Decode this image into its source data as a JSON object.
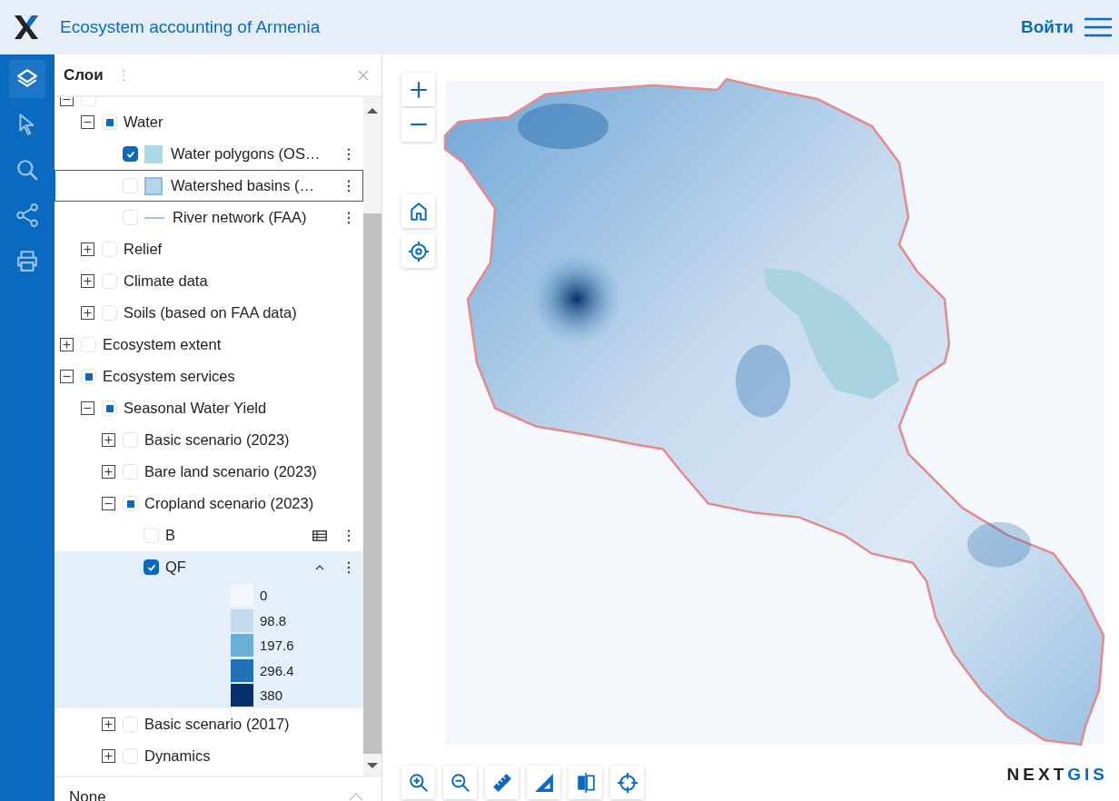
{
  "header": {
    "title": "Ecosystem accounting of Armenia",
    "login": "Войти"
  },
  "sidebar": {
    "tools": [
      {
        "kind": "layers",
        "selected": true
      },
      {
        "kind": "select",
        "selected": false
      },
      {
        "kind": "search",
        "selected": false
      },
      {
        "kind": "share",
        "selected": false
      },
      {
        "kind": "print",
        "selected": false
      }
    ]
  },
  "panel": {
    "title": "Слои",
    "tree": [
      {
        "kind": "group",
        "expanded": true,
        "partial": false,
        "children": [
          {
            "label": "Water",
            "kind": "group",
            "expanded": true,
            "partial": true,
            "children": [
              {
                "label": "Water polygons (OS…",
                "kind": "fill",
                "checked": true,
                "color": "#add8e6"
              },
              {
                "label": "Watershed basins (…",
                "kind": "outline",
                "checked": false,
                "focused": true,
                "color": "#b9d3ea"
              },
              {
                "label": "River network (FAA)",
                "kind": "line",
                "checked": false,
                "color": "#9ec3e6"
              }
            ]
          },
          {
            "label": "Relief",
            "kind": "group",
            "expanded": false,
            "partial": false
          },
          {
            "label": "Climate data",
            "kind": "group",
            "expanded": false,
            "partial": false
          },
          {
            "label": "Soils (based on FAA data)",
            "kind": "group",
            "expanded": false,
            "partial": false
          }
        ]
      },
      {
        "label": "Ecosystem extent",
        "kind": "group",
        "expanded": false,
        "partial": false
      },
      {
        "label": "Ecosystem services",
        "kind": "group",
        "expanded": true,
        "partial": true,
        "children": [
          {
            "label": "Seasonal Water Yield",
            "kind": "group",
            "expanded": true,
            "partial": true,
            "children": [
              {
                "label": "Basic scenario (2023)",
                "kind": "group",
                "expanded": false,
                "partial": false
              },
              {
                "label": "Bare land scenario (2023)",
                "kind": "group",
                "expanded": false,
                "partial": false
              },
              {
                "label": "Cropland scenario (2023)",
                "kind": "group",
                "expanded": true,
                "partial": true,
                "children": [
                  {
                    "label": "B",
                    "kind": "raster",
                    "checked": false,
                    "table": true
                  },
                  {
                    "label": "QF",
                    "kind": "raster",
                    "checked": true,
                    "selected": true,
                    "legend_open": true,
                    "legend": [
                      {
                        "label": "0",
                        "color": "#f4f8fd"
                      },
                      {
                        "label": "98.8",
                        "color": "#c6daef"
                      },
                      {
                        "label": "197.6",
                        "color": "#6baed6"
                      },
                      {
                        "label": "296.4",
                        "color": "#2171b5"
                      },
                      {
                        "label": "380",
                        "color": "#08306b"
                      }
                    ]
                  }
                ]
              },
              {
                "label": "Basic scenario (2017)",
                "kind": "group",
                "expanded": false,
                "partial": false
              },
              {
                "label": "Dynamics",
                "kind": "group",
                "expanded": false,
                "partial": false
              }
            ]
          }
        ]
      }
    ],
    "bottom_panel": {
      "title": "None"
    }
  },
  "map": {
    "logo": {
      "dark": "NEXT",
      "accent": "GIS"
    }
  }
}
